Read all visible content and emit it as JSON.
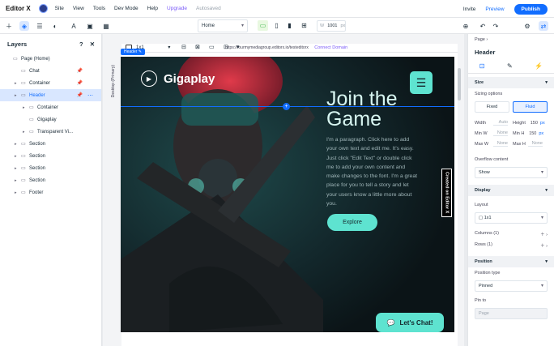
{
  "topbar": {
    "logo": "Editor X",
    "menu": [
      "Site",
      "View",
      "Tools",
      "Dev Mode",
      "Help",
      "Upgrade",
      "Autosaved"
    ],
    "invite": "Invite",
    "preview": "Preview",
    "publish": "Publish"
  },
  "toolbar": {
    "page": "Home",
    "width_label": "W",
    "width_value": "1001",
    "width_unit": "px",
    "grid_value": "1x1"
  },
  "layers": {
    "title": "Layers",
    "help": "?",
    "close": "✕",
    "rows": [
      {
        "label": "Page (Home)",
        "indent": 0,
        "arrow": false
      },
      {
        "label": "Chat",
        "indent": 1,
        "arrow": false
      },
      {
        "label": "Container",
        "indent": 1,
        "arrow": true
      },
      {
        "label": "Header",
        "indent": 1,
        "arrow": true,
        "selected": true
      },
      {
        "label": "Container",
        "indent": 2,
        "arrow": true
      },
      {
        "label": "Gigaplay",
        "indent": 2,
        "arrow": false
      },
      {
        "label": "Transparent Vi...",
        "indent": 2,
        "arrow": true
      },
      {
        "label": "Section",
        "indent": 1,
        "arrow": true
      },
      {
        "label": "Section",
        "indent": 1,
        "arrow": true
      },
      {
        "label": "Section",
        "indent": 1,
        "arrow": true
      },
      {
        "label": "Section",
        "indent": 1,
        "arrow": true
      },
      {
        "label": "Footer",
        "indent": 1,
        "arrow": true
      }
    ]
  },
  "canvas": {
    "url": "https://fourmymediagroup.editorx.io/testeditorx",
    "connect_domain": "Connect Domain",
    "header_tag": "Header",
    "side_label": "Desktop (Primary)",
    "created_badge": "Created on Editor X"
  },
  "hero": {
    "logo_text": "Gigaplay",
    "headline_1": "Join the",
    "headline_2": "Game",
    "paragraph": "I'm a paragraph. Click here to add your own text and edit me. It's easy. Just click \"Edit Text\" or double click me to add your own content and make changes to the font. I'm a great place for you to tell a story and let your users know a little more about you.",
    "explore": "Explore",
    "chat": "Let's Chat!",
    "accent_color": "#5ee3d0"
  },
  "inspector": {
    "crumb": "Page",
    "title": "Header",
    "size_section": "Size",
    "sizing_options": "Sizing options",
    "fixed": "Fixed",
    "fluid": "Fluid",
    "width": "Width",
    "width_auto": "Auto",
    "height": "Height",
    "height_val": "150",
    "min_w": "Min W",
    "min_w_val": "None",
    "min_h": "Min H",
    "min_h_val": "150",
    "max_w": "Max W",
    "max_w_val": "None",
    "max_h": "Max H",
    "max_h_val": "None",
    "px": "px",
    "overflow": "Overflow content",
    "overflow_val": "Show",
    "display_section": "Display",
    "layout": "Layout",
    "layout_val": "1x1",
    "columns": "Columns (1)",
    "rows": "Rows (1)",
    "position_section": "Position",
    "position_type": "Position type",
    "position_val": "Pinned",
    "pin_to": "Pin to",
    "pin_val": "Page"
  }
}
